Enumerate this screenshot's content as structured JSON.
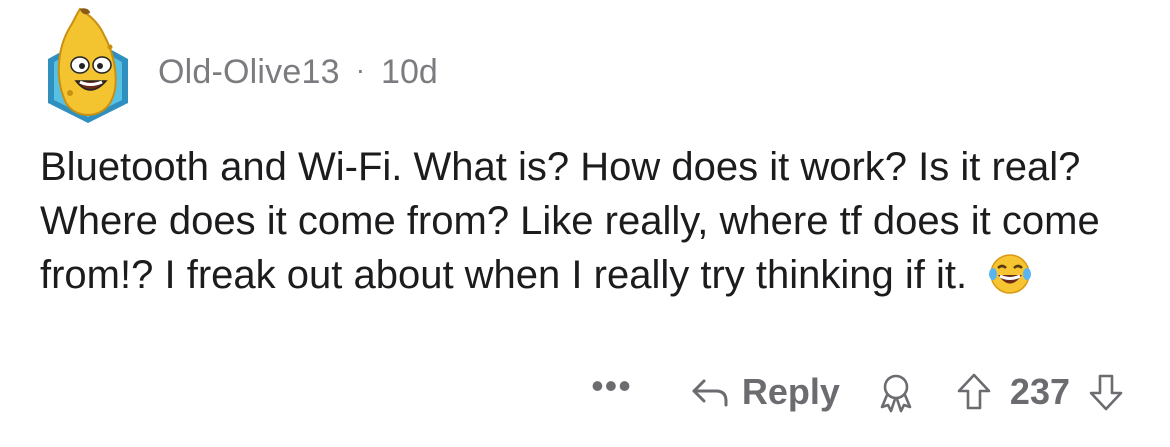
{
  "comment": {
    "username": "Old-Olive13",
    "separator": "·",
    "age": "10d",
    "text": "Bluetooth and Wi-Fi. What is? How does it work? Is it real? Where does it come from? Like really, where tf does it come from!? I freak out about when I really try thinking if it.",
    "emoji": "laughing-crying-emoji"
  },
  "actions": {
    "more_label": "•••",
    "reply_label": "Reply",
    "vote_count": "237"
  },
  "colors": {
    "meta": "#7c7c80",
    "text": "#1c1c1e",
    "action": "#6b6b70",
    "avatar_bg": "#3aa6c9",
    "banana": "#f4c430"
  }
}
